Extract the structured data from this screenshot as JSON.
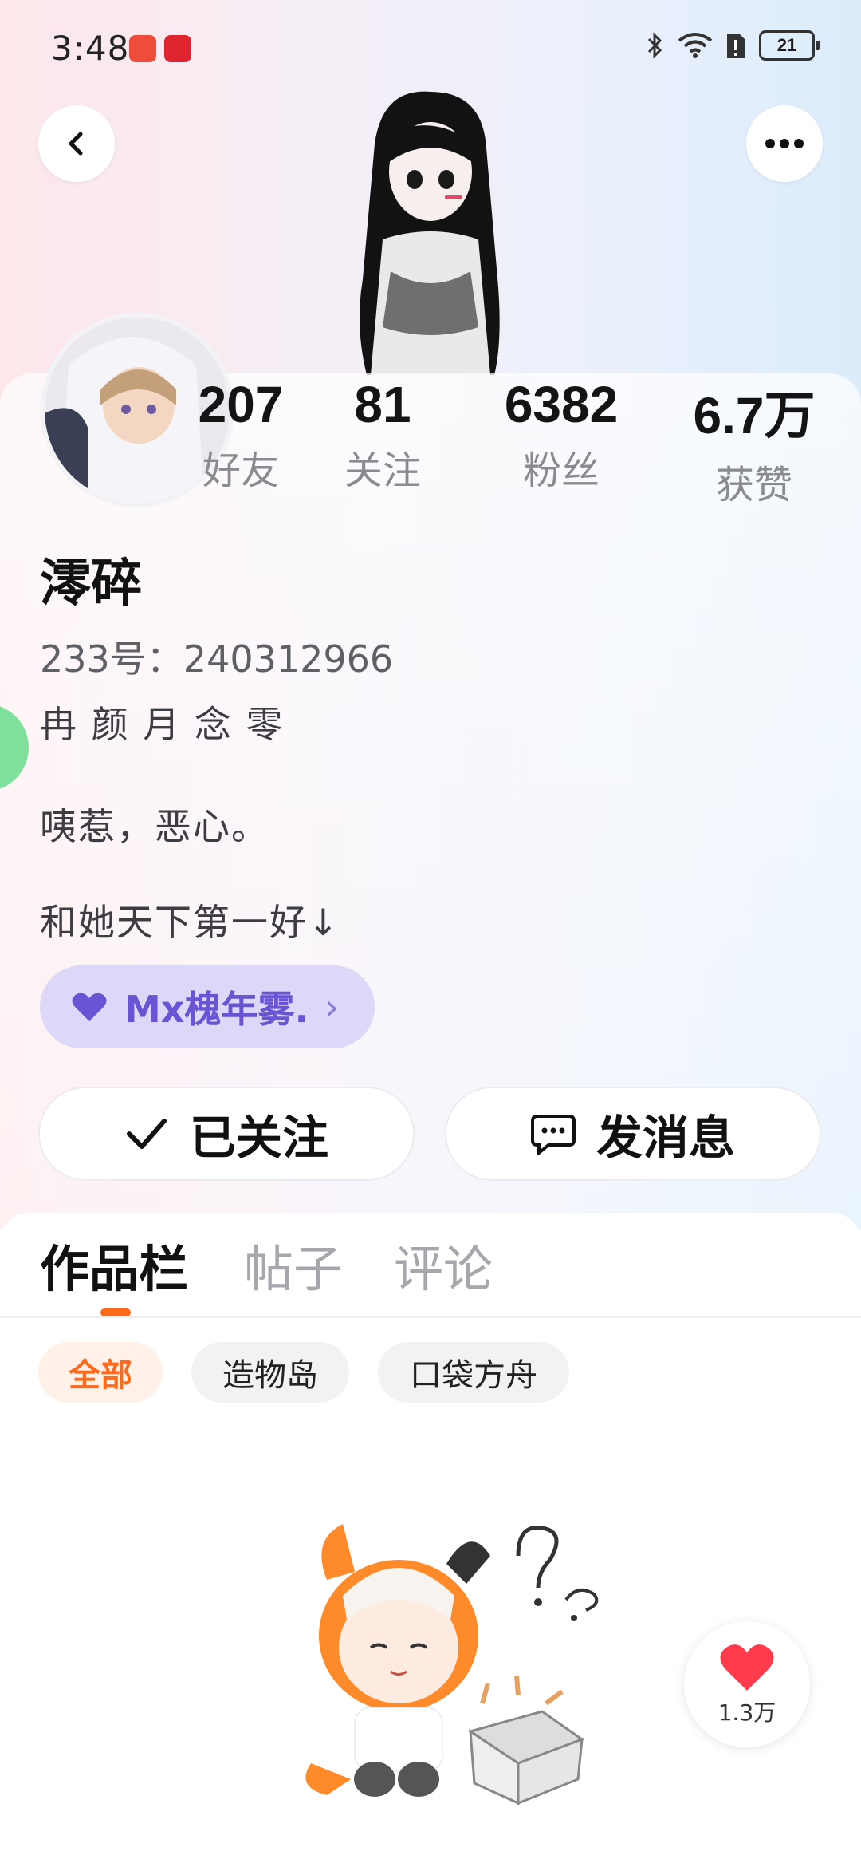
{
  "status_bar": {
    "time": "3:48",
    "battery": "21"
  },
  "profile": {
    "name": "澪碎",
    "id_text": "233号：240312966",
    "bio_lines": [
      "冉 颜 月 念 零",
      "咦惹，恶心。",
      "和她天下第一好↓"
    ],
    "linked_user": "Mx槐年雾.",
    "linked_user_chevron": "›"
  },
  "stats": [
    {
      "value": "207",
      "label": "好友"
    },
    {
      "value": "81",
      "label": "关注"
    },
    {
      "value": "6382",
      "label": "粉丝"
    },
    {
      "value": "6.7万",
      "label": "获赞"
    }
  ],
  "actions": {
    "follow_label": "已关注",
    "message_label": "发消息"
  },
  "tabs": [
    {
      "label": "作品栏",
      "active": true
    },
    {
      "label": "帖子",
      "active": false
    },
    {
      "label": "评论",
      "active": false
    }
  ],
  "filters": [
    {
      "label": "全部",
      "active": true
    },
    {
      "label": "造物岛",
      "active": false
    },
    {
      "label": "口袋方舟",
      "active": false
    }
  ],
  "like_count": "1.3万",
  "colors": {
    "accent": "#ff6a1a",
    "pill_bg": "#ddd8f7",
    "pill_text": "#6a54d4"
  }
}
